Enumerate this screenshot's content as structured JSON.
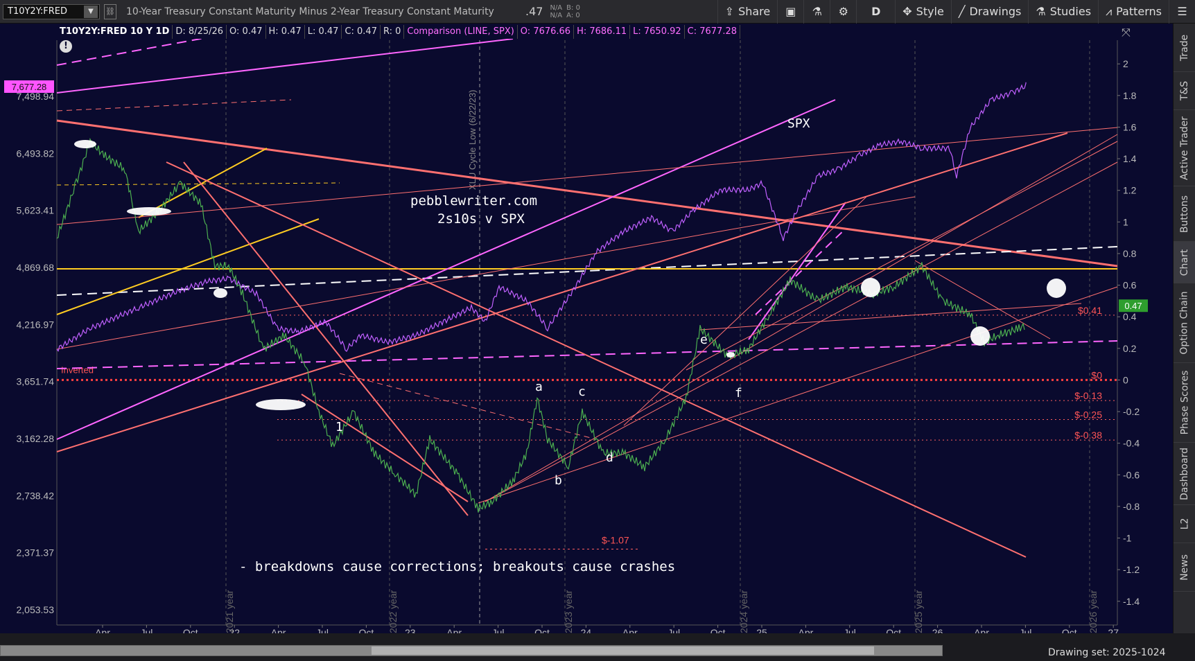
{
  "toolbar": {
    "symbol": "T10Y2Y:FRED",
    "description": "10-Year Treasury Constant Maturity Minus 2-Year Treasury Constant Maturity",
    "last": ".47",
    "na1": "N/A",
    "na2": "N/A",
    "bid": "B: 0",
    "ask": "A: 0",
    "share": "Share",
    "aggregation": "D",
    "style": "Style",
    "drawings": "Drawings",
    "studies": "Studies",
    "patterns": "Patterns"
  },
  "infobar": {
    "title": "T10Y2Y:FRED 10 Y 1D",
    "date": "D: 8/25/26",
    "open": "O: 0.47",
    "high": "H: 0.47",
    "low": "L: 0.47",
    "close": "C: 0.47",
    "r": "R: 0",
    "comparison": "Comparison (LINE, SPX)",
    "cmp_open": "O: 7676.66",
    "cmp_high": "H: 7686.11",
    "cmp_low": "L: 7650.92",
    "cmp_close": "C: 7677.28"
  },
  "right_tabs": [
    "Trade",
    "T&S",
    "Active Trader",
    "Buttons",
    "Chart",
    "Option Chain",
    "Phase Scores",
    "Dashboard",
    "L2",
    "News"
  ],
  "status": {
    "drawing_set": "Drawing set: 2025-1024"
  },
  "chart_data": {
    "type": "line",
    "right_axis": {
      "ticks": [
        "2",
        "1.8",
        "1.6",
        "1.4",
        "1.2",
        "1",
        "0.8",
        "0.6",
        "0.4",
        "0.2",
        "0",
        "-0.2",
        "-0.4",
        "-0.6",
        "-0.8",
        "-1",
        "-1.2",
        "-1.4"
      ],
      "ylim": [
        -1.55,
        2.15
      ]
    },
    "left_axis": {
      "ticks": [
        "7,498.94",
        "6,493.82",
        "5,623.41",
        "4,869.68",
        "4,216.97",
        "3,651.74",
        "3,162.28",
        "2,738.42",
        "2,371.37",
        "2,053.53"
      ],
      "scale": "log"
    },
    "x_ticks": [
      "Apr",
      "Jul",
      "Oct",
      "22",
      "Apr",
      "Jul",
      "Oct",
      "23",
      "Apr",
      "Jul",
      "Oct",
      "24",
      "Apr",
      "Jul",
      "Oct",
      "25",
      "Apr",
      "Jul",
      "Oct",
      "26",
      "Apr",
      "Jul",
      "Oct",
      "27"
    ],
    "year_labels": [
      "2021 year",
      "2022 year",
      "2023 year",
      "2024 year",
      "2025 year",
      "2026 year"
    ],
    "current_value": "0.47",
    "spx_label": "7,677.28",
    "price_levels": [
      {
        "label": "$0.41",
        "value": 0.41
      },
      {
        "label": "$0",
        "value": 0
      },
      {
        "label": "$-0.13",
        "value": -0.13
      },
      {
        "label": "$-0.25",
        "value": -0.25
      },
      {
        "label": "$-0.38",
        "value": -0.38
      },
      {
        "label": "$-1.07",
        "value": -1.07
      }
    ],
    "annotations": {
      "site": "pebblewriter.com",
      "subtitle": "2s10s v SPX",
      "spx": "SPX",
      "note": "- breakdowns cause corrections; breakouts cause crashes",
      "cycle": "XLU Cycle Low (6/22/23)",
      "inverted": "Inverted",
      "waves": [
        "1",
        "a",
        "b",
        "c",
        "d",
        "e",
        "f"
      ]
    },
    "series": [
      {
        "name": "T10Y2Y:FRED",
        "color": "#4caf50"
      },
      {
        "name": "SPX",
        "color": "#c060ff"
      }
    ]
  }
}
